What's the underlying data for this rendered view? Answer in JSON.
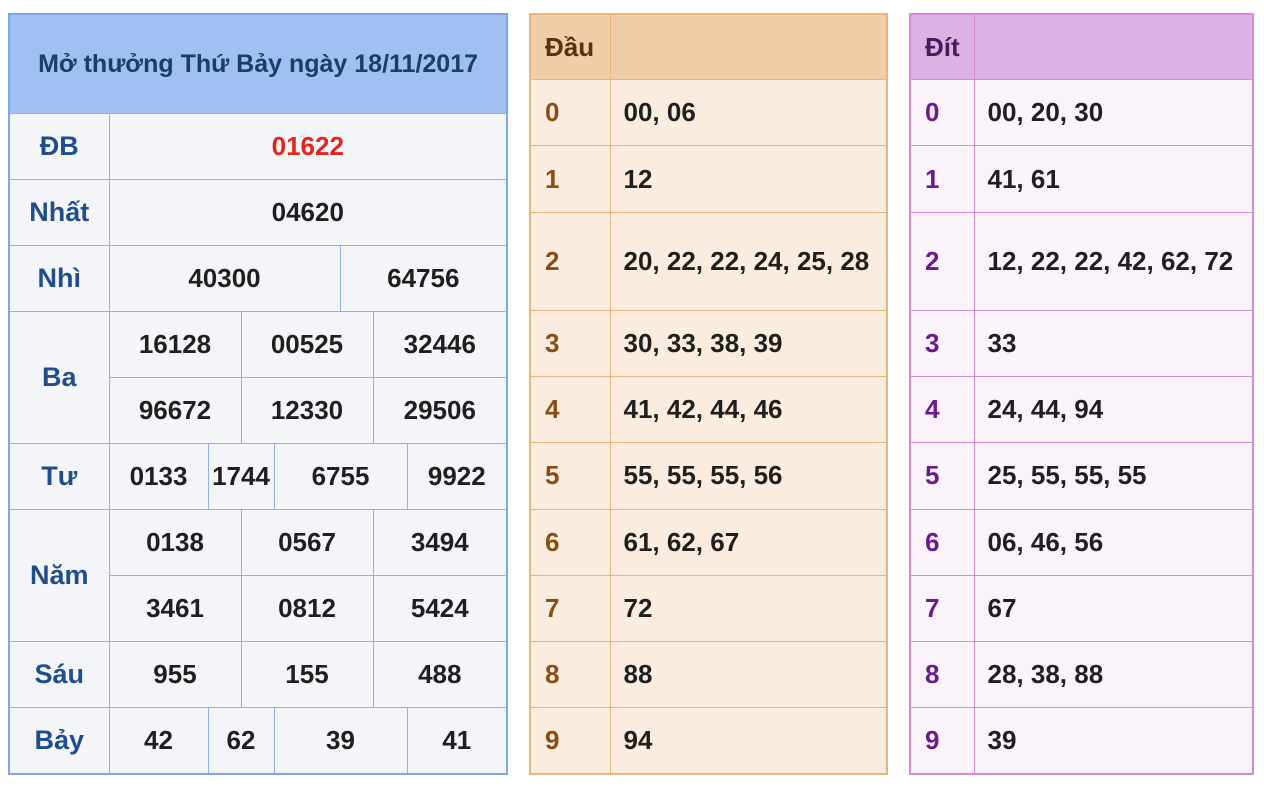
{
  "results": {
    "title": "Mở thưởng Thứ Bảy ngày 18/11/2017",
    "prizes": {
      "db": {
        "label": "ĐB",
        "values": [
          "01622"
        ]
      },
      "nhat": {
        "label": "Nhất",
        "values": [
          "04620"
        ]
      },
      "nhi": {
        "label": "Nhì",
        "values": [
          "40300",
          "64756"
        ]
      },
      "ba": {
        "label": "Ba",
        "values": [
          "16128",
          "00525",
          "32446",
          "96672",
          "12330",
          "29506"
        ]
      },
      "tu": {
        "label": "Tư",
        "values": [
          "0133",
          "1744",
          "6755",
          "9922"
        ]
      },
      "nam": {
        "label": "Năm",
        "values": [
          "0138",
          "0567",
          "3494",
          "3461",
          "0812",
          "5424"
        ]
      },
      "sau": {
        "label": "Sáu",
        "values": [
          "955",
          "155",
          "488"
        ]
      },
      "bay": {
        "label": "Bảy",
        "values": [
          "42",
          "62",
          "39",
          "41"
        ]
      }
    },
    "special_color": "#e8231c",
    "accent": "#7ea7e8"
  },
  "heads": {
    "header": "Đầu",
    "accent": "#ebb47c",
    "rows": [
      {
        "key": "0",
        "value": "00, 06"
      },
      {
        "key": "1",
        "value": "12"
      },
      {
        "key": "2",
        "value": "20, 22, 22, 24, 25, 28"
      },
      {
        "key": "3",
        "value": "30, 33, 38, 39"
      },
      {
        "key": "4",
        "value": "41, 42, 44, 46"
      },
      {
        "key": "5",
        "value": "55, 55, 55, 56"
      },
      {
        "key": "6",
        "value": "61, 62, 67"
      },
      {
        "key": "7",
        "value": "72"
      },
      {
        "key": "8",
        "value": "88"
      },
      {
        "key": "9",
        "value": "94"
      }
    ]
  },
  "tails": {
    "header": "Đít",
    "accent": "#d68ad6",
    "rows": [
      {
        "key": "0",
        "value": "00, 20, 30"
      },
      {
        "key": "1",
        "value": "41, 61"
      },
      {
        "key": "2",
        "value": "12, 22, 22, 42, 62, 72"
      },
      {
        "key": "3",
        "value": "33"
      },
      {
        "key": "4",
        "value": "24, 44, 94"
      },
      {
        "key": "5",
        "value": "25, 55, 55, 55"
      },
      {
        "key": "6",
        "value": "06, 46, 56"
      },
      {
        "key": "7",
        "value": "67"
      },
      {
        "key": "8",
        "value": "28, 38, 88"
      },
      {
        "key": "9",
        "value": "39"
      }
    ]
  }
}
